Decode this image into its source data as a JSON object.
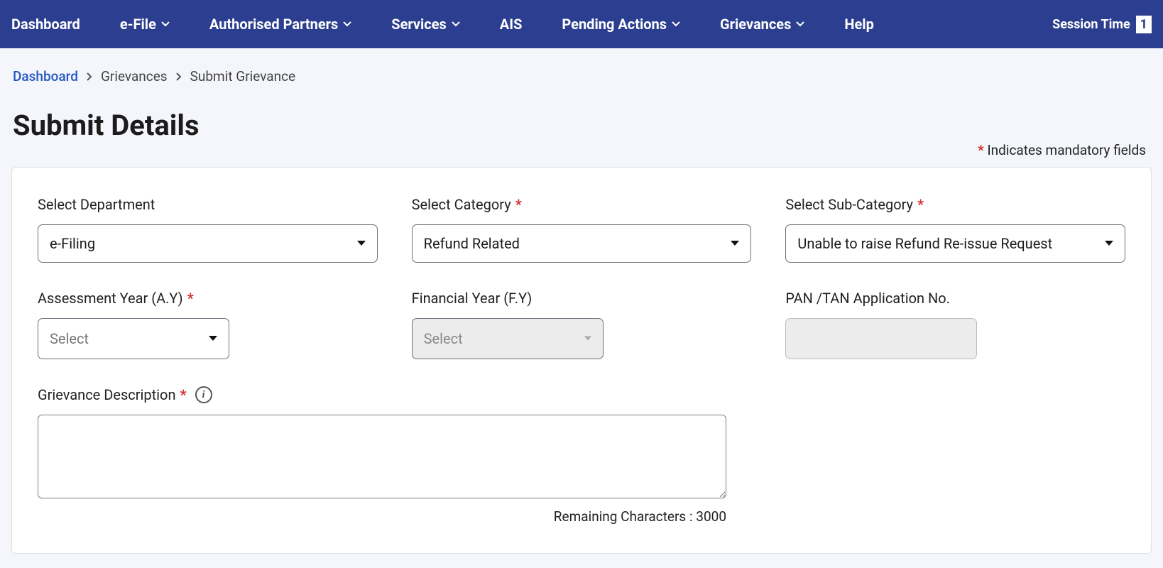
{
  "nav": {
    "items": [
      {
        "label": "Dashboard",
        "hasDropdown": false
      },
      {
        "label": "e-File",
        "hasDropdown": true
      },
      {
        "label": "Authorised Partners",
        "hasDropdown": true
      },
      {
        "label": "Services",
        "hasDropdown": true
      },
      {
        "label": "AIS",
        "hasDropdown": false
      },
      {
        "label": "Pending Actions",
        "hasDropdown": true
      },
      {
        "label": "Grievances",
        "hasDropdown": true
      },
      {
        "label": "Help",
        "hasDropdown": false
      }
    ],
    "sessionTimeLabel": "Session Time",
    "sessionTimeValue": "1"
  },
  "breadcrumb": {
    "items": [
      "Dashboard",
      "Grievances",
      "Submit Grievance"
    ]
  },
  "pageTitle": "Submit Details",
  "mandatoryNote": "Indicates mandatory fields",
  "star": "*",
  "form": {
    "department": {
      "label": "Select Department",
      "value": "e-Filing"
    },
    "category": {
      "label": "Select Category",
      "value": "Refund Related"
    },
    "subcategory": {
      "label": "Select Sub-Category",
      "value": "Unable to raise Refund Re-issue Request"
    },
    "assessmentYear": {
      "label": "Assessment Year (A.Y)",
      "placeholder": "Select"
    },
    "financialYear": {
      "label": "Financial Year (F.Y)",
      "placeholder": "Select"
    },
    "panTan": {
      "label": "PAN /TAN Application No.",
      "value": ""
    },
    "description": {
      "label": "Grievance Description",
      "value": "",
      "remainingLabel": "Remaining Characters :",
      "remainingValue": "3000"
    }
  }
}
